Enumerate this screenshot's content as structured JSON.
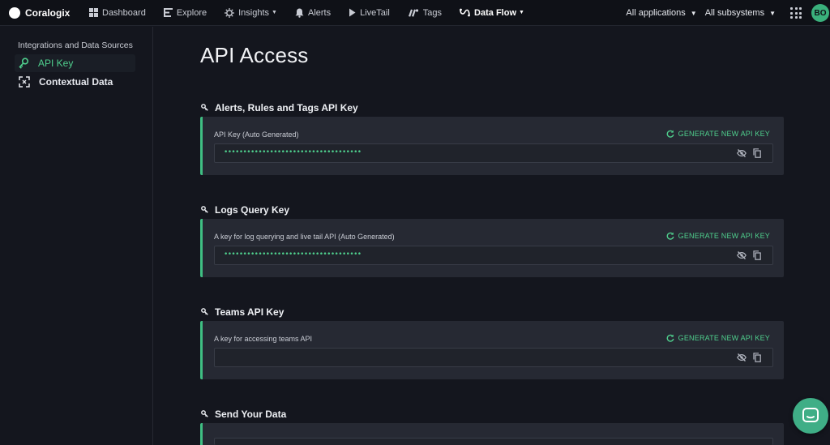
{
  "app": {
    "name": "Coralogix"
  },
  "nav": {
    "items": [
      {
        "label": "Dashboard",
        "icon": "dashboard-icon"
      },
      {
        "label": "Explore",
        "icon": "explore-icon"
      },
      {
        "label": "Insights",
        "icon": "insights-icon",
        "dropdown": true
      },
      {
        "label": "Alerts",
        "icon": "bell-icon"
      },
      {
        "label": "LiveTail",
        "icon": "play-icon"
      },
      {
        "label": "Tags",
        "icon": "tags-icon"
      },
      {
        "label": "Data Flow",
        "icon": "data-flow-icon",
        "dropdown": true,
        "active": true
      }
    ],
    "applications": "All applications",
    "subsystems": "All subsystems",
    "avatar": "BO"
  },
  "sidebar": {
    "heading": "Integrations and Data Sources",
    "items": [
      {
        "label": "API Key",
        "icon": "key-icon",
        "active": true
      },
      {
        "label": "Contextual Data",
        "icon": "contextual-data-icon",
        "active": false
      }
    ]
  },
  "main": {
    "title": "API Access",
    "generate_label": "GENERATE NEW API KEY",
    "sections": [
      {
        "title": "Alerts, Rules and Tags API Key",
        "label": "API Key (Auto Generated)",
        "value": "••••••••••••••••••••••••••••••••••••"
      },
      {
        "title": "Logs Query Key",
        "label": "A key for log querying and live tail API (Auto Generated)",
        "value": "••••••••••••••••••••••••••••••••••••"
      },
      {
        "title": "Teams API Key",
        "label": "A key for accessing teams API",
        "value": ""
      },
      {
        "title": "Send Your Data",
        "label": "",
        "value": ""
      }
    ]
  },
  "colors": {
    "accent": "#4fcf8d",
    "background": "#14161e",
    "card": "#262933",
    "topbar": "#0f1117"
  }
}
